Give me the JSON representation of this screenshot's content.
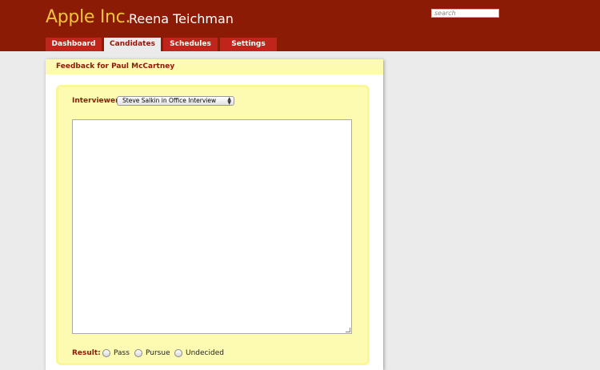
{
  "header": {
    "company": "Apple Inc.",
    "user": "Reena Teichman",
    "search_placeholder": "search"
  },
  "tabs": [
    {
      "label": "Dashboard",
      "active": false
    },
    {
      "label": "Candidates",
      "active": true
    },
    {
      "label": "Schedules",
      "active": false
    },
    {
      "label": "Settings",
      "active": false
    }
  ],
  "panel": {
    "title": "Feedback for Paul McCartney",
    "interviewer_label": "Interviewer",
    "interviewer_selected": "Steve Salkin in Office Interview",
    "feedback_text": "",
    "result_label": "Result:",
    "result_options": [
      "Pass",
      "Pursue",
      "Undecided"
    ]
  },
  "colors": {
    "header_bg": "#8c1b06",
    "company_text": "#f2c23b",
    "tab_bg": "#c1241b",
    "panel_yellow": "#fdfbb2"
  }
}
